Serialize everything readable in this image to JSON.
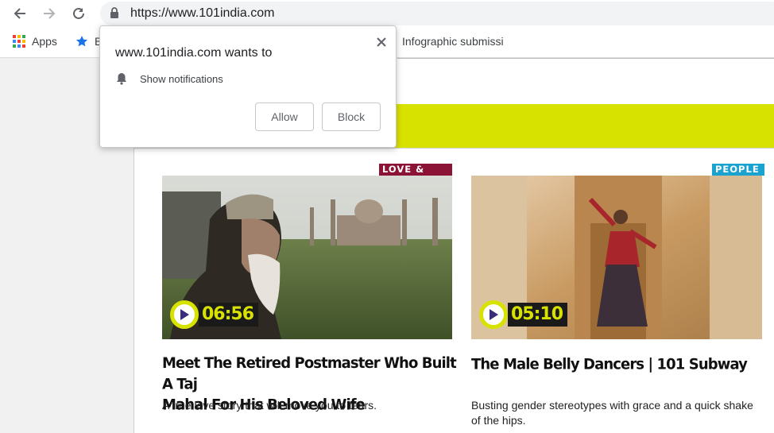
{
  "browser": {
    "url": "https://www.101india.com",
    "bookmarks": [
      {
        "label": "Apps",
        "icon": "apps-grid-icon"
      },
      {
        "label": "B",
        "icon": "star-icon"
      },
      {
        "label": "Infographic submissi",
        "icon": ""
      }
    ]
  },
  "permission_popup": {
    "title": "www.101india.com wants to",
    "permission": "Show notifications",
    "allow_label": "Allow",
    "block_label": "Block"
  },
  "videos": [
    {
      "category": "LOVE & SEX",
      "category_color": "#8b1436",
      "duration": "06:56",
      "title_line1": "Meet The Retired Postmaster Who Built A Taj",
      "title_line2": "Mahal For His Beloved Wife",
      "description": "A true love story that will move you to tears."
    },
    {
      "category": "PEOPLE",
      "category_color": "#1ba3cf",
      "duration": "05:10",
      "title_line1": "The Male Belly Dancers | 101 Subway",
      "title_line2": "",
      "description": "Busting gender stereotypes with grace and a quick shake of the hips."
    }
  ],
  "theme": {
    "accent": "#d8e200",
    "text": "#111111"
  }
}
